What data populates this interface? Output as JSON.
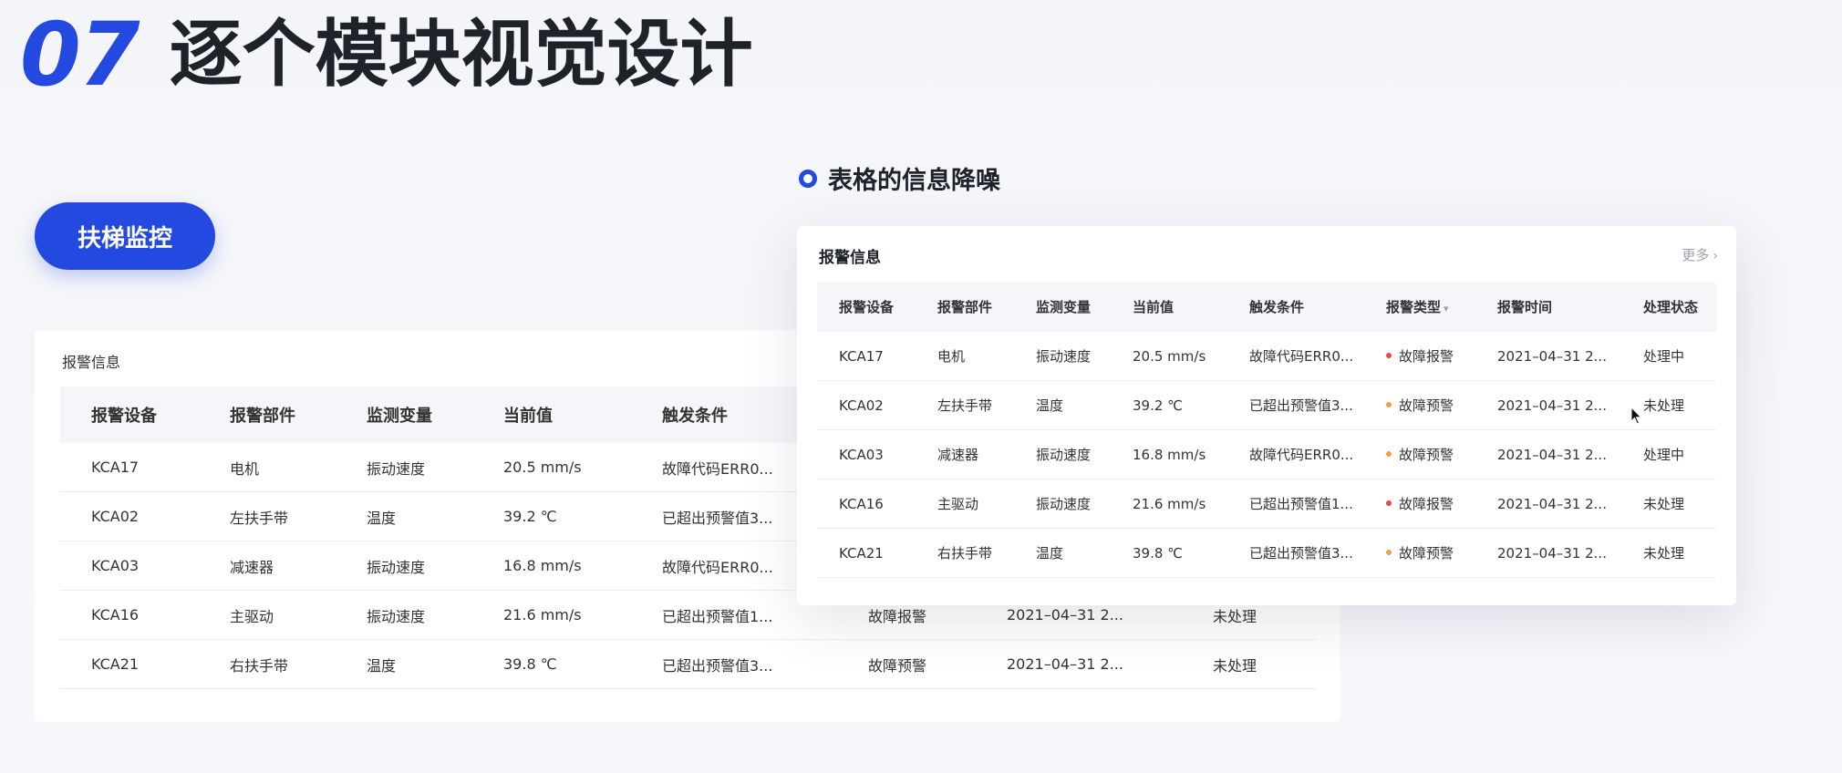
{
  "header": {
    "number": "07",
    "title": "逐个模块视觉设计"
  },
  "section_label": "表格的信息降噪",
  "pill_label": "扶梯监控",
  "back_card": {
    "title": "报警信息",
    "columns": [
      "报警设备",
      "报警部件",
      "监测变量",
      "当前值",
      "触发条件"
    ],
    "rows": [
      {
        "device": "KCA17",
        "part": "电机",
        "variable": "振动速度",
        "value": "20.5 mm/s",
        "condition": "故障代码ERR0...",
        "type": "",
        "time": "",
        "status": ""
      },
      {
        "device": "KCA02",
        "part": "左扶手带",
        "variable": "温度",
        "value": "39.2 ℃",
        "condition": "已超出预警值3...",
        "type": "",
        "time": "",
        "status": ""
      },
      {
        "device": "KCA03",
        "part": "减速器",
        "variable": "振动速度",
        "value": "16.8 mm/s",
        "condition": "故障代码ERR0...",
        "type": "",
        "time": "",
        "status": ""
      },
      {
        "device": "KCA16",
        "part": "主驱动",
        "variable": "振动速度",
        "value": "21.6 mm/s",
        "condition": "已超出预警值1...",
        "type": "故障报警",
        "time": "2021–04–31  2...",
        "status": "未处理"
      },
      {
        "device": "KCA21",
        "part": "右扶手带",
        "variable": "温度",
        "value": "39.8 ℃",
        "condition": "已超出预警值3...",
        "type": "故障预警",
        "time": "2021–04–31  2...",
        "status": "未处理"
      }
    ]
  },
  "front_card": {
    "title": "报警信息",
    "more_label": "更多",
    "columns": [
      "报警设备",
      "报警部件",
      "监测变量",
      "当前值",
      "触发条件",
      "报警类型",
      "报警时间",
      "处理状态"
    ],
    "rows": [
      {
        "device": "KCA17",
        "part": "电机",
        "variable": "振动速度",
        "value": "20.5 mm/s",
        "condition": "故障代码ERR0...",
        "type": "故障报警",
        "time": "2021–04–31  2...",
        "status": "处理中"
      },
      {
        "device": "KCA02",
        "part": "左扶手带",
        "variable": "温度",
        "value": "39.2 ℃",
        "condition": "已超出预警值3...",
        "type": "故障预警",
        "time": "2021–04–31  2...",
        "status": "未处理"
      },
      {
        "device": "KCA03",
        "part": "减速器",
        "variable": "振动速度",
        "value": "16.8 mm/s",
        "condition": "故障代码ERR0...",
        "type": "故障预警",
        "time": "2021–04–31  2...",
        "status": "处理中"
      },
      {
        "device": "KCA16",
        "part": "主驱动",
        "variable": "振动速度",
        "value": "21.6 mm/s",
        "condition": "已超出预警值1...",
        "type": "故障报警",
        "time": "2021–04–31  2...",
        "status": "未处理"
      },
      {
        "device": "KCA21",
        "part": "右扶手带",
        "variable": "温度",
        "value": "39.8 ℃",
        "condition": "已超出预警值3...",
        "type": "故障预警",
        "time": "2021–04–31  2...",
        "status": "未处理"
      }
    ]
  },
  "colors": {
    "accent": "#2349e0",
    "error": "#e5484d",
    "warning": "#f0a03a"
  },
  "icons": [
    "ring-bullet-icon",
    "chevron-right-icon",
    "sort-down-icon",
    "mouse-cursor-icon"
  ]
}
